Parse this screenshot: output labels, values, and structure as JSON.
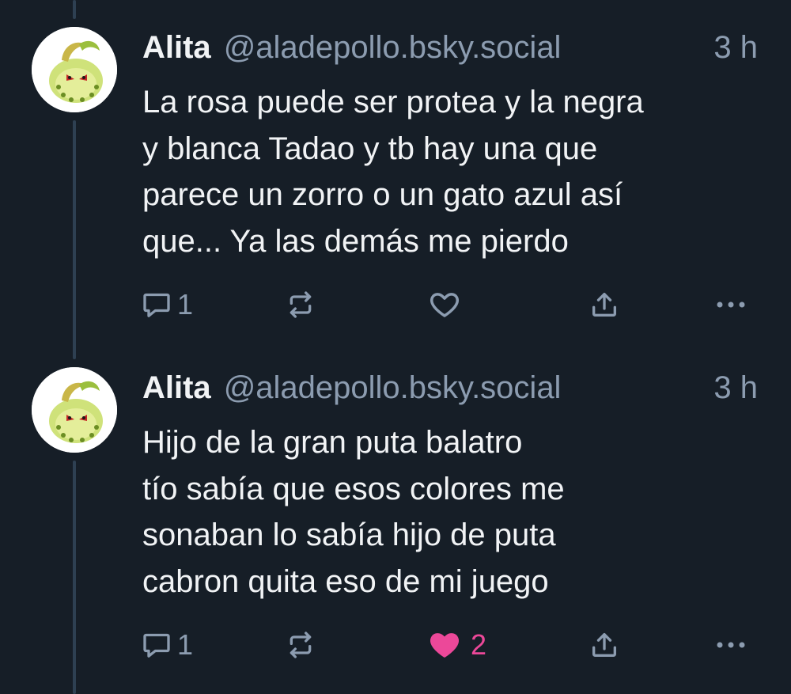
{
  "posts": [
    {
      "author": "Alita",
      "handle": "@aladepollo.bsky.social",
      "time": "3 h",
      "text": "La rosa puede ser protea y la negra\ny blanca Tadao y tb hay una que\nparece un zorro o un gato azul así\nque... Ya las demás me pierdo",
      "reply_count": "1",
      "repost_count": "",
      "like_count": "",
      "liked": false
    },
    {
      "author": "Alita",
      "handle": "@aladepollo.bsky.social",
      "time": "3 h",
      "text": "Hijo de la gran puta balatro\ntío sabía que esos colores me\nsonaban lo sabía hijo de puta\ncabron quita eso de mi juego",
      "reply_count": "1",
      "repost_count": "",
      "like_count": "2",
      "liked": true
    }
  ],
  "colors": {
    "background": "#161e27",
    "text": "#f1f3f5",
    "muted": "#8c9cb0",
    "like_active": "#ec4899",
    "thread_line": "#2e4052"
  },
  "icons": {
    "reply": "speech-bubble-icon",
    "repost": "repost-arrows-icon",
    "like": "heart-icon",
    "share": "share-upload-icon",
    "more": "ellipsis-icon"
  }
}
